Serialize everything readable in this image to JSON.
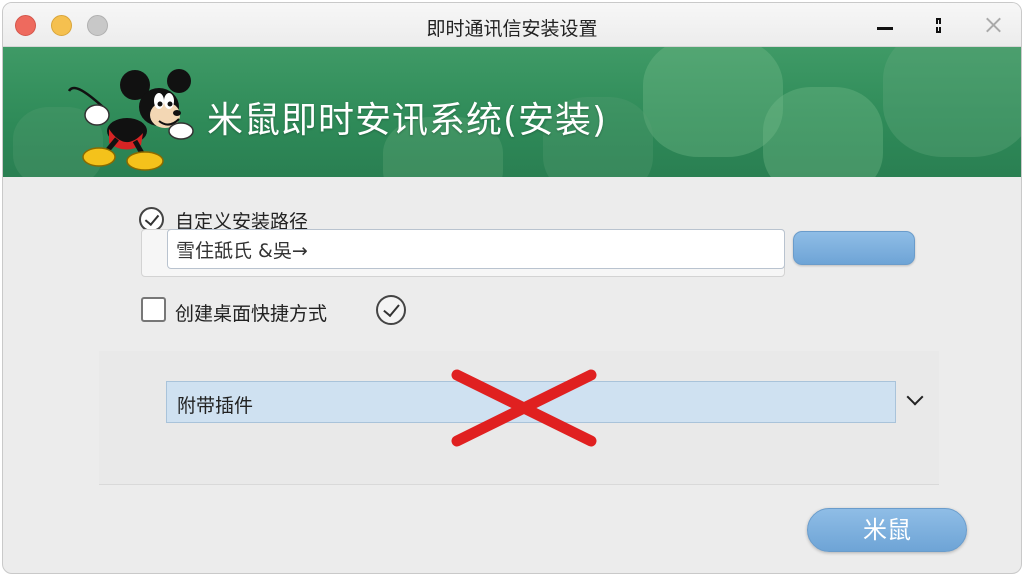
{
  "window": {
    "title": "即时通讯信安装设置"
  },
  "banner": {
    "title": "米鼠即时安讯系统(安装)"
  },
  "install_path": {
    "label": "自定义安装路径",
    "checked": true,
    "value": "雪住舐氏 &吳→"
  },
  "shortcut": {
    "label": "创建桌面快捷方式",
    "checked": false
  },
  "plugins": {
    "label": "附带插件"
  },
  "footer": {
    "install_label": "米鼠"
  },
  "colors": {
    "banner_green": "#2e8a58",
    "button_blue": "#7fb1e0",
    "red_mark": "#e02020"
  }
}
